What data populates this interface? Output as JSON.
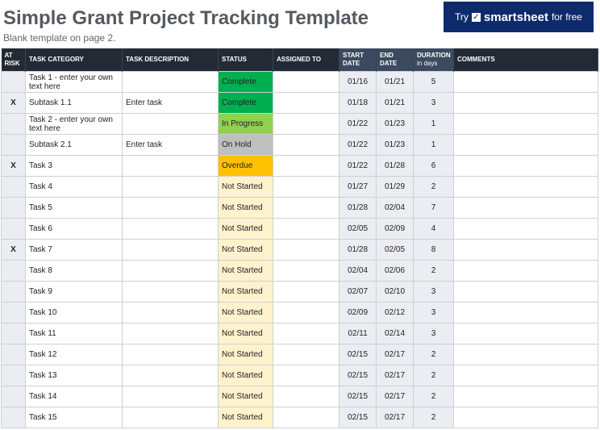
{
  "title": "Simple Grant Project Tracking Template",
  "subtitle": "Blank template on page 2.",
  "banner": {
    "try": "Try",
    "brand": "smartsheet",
    "suffix": "for free",
    "check_glyph": "✓"
  },
  "colors": {
    "complete": "#00b050",
    "in_progress": "#92d050",
    "on_hold": "#bfbfbf",
    "overdue": "#ffc000",
    "not_started": "#fff2cc",
    "header": "#222b35",
    "banner": "#0d2a6b"
  },
  "headers": {
    "at_risk_1": "AT",
    "at_risk_2": "RISK",
    "task_category": "TASK CATEGORY",
    "task_description": "TASK DESCRIPTION",
    "status": "STATUS",
    "assigned_to": "ASSIGNED TO",
    "start_1": "START",
    "start_2": "DATE",
    "end_1": "END",
    "end_2": "DATE",
    "duration_1": "DURATION",
    "duration_2": "in days",
    "comments": "COMMENTS"
  },
  "rows": [
    {
      "risk": "",
      "category": "Task 1 - enter your own text here",
      "description": "",
      "status": "Complete",
      "status_class": "st-complete",
      "assigned": "",
      "start": "01/16",
      "end": "01/21",
      "duration": "5",
      "comments": ""
    },
    {
      "risk": "X",
      "category": "Subtask 1.1",
      "description": "Enter task",
      "status": "Complete",
      "status_class": "st-complete",
      "assigned": "",
      "start": "01/18",
      "end": "01/21",
      "duration": "3",
      "comments": ""
    },
    {
      "risk": "",
      "category": "Task 2 - enter your own text here",
      "description": "",
      "status": "In Progress",
      "status_class": "st-progress",
      "assigned": "",
      "start": "01/22",
      "end": "01/23",
      "duration": "1",
      "comments": ""
    },
    {
      "risk": "",
      "category": "Subtask 2.1",
      "description": "Enter task",
      "status": "On Hold",
      "status_class": "st-hold",
      "assigned": "",
      "start": "01/22",
      "end": "01/23",
      "duration": "1",
      "comments": ""
    },
    {
      "risk": "X",
      "category": "Task 3",
      "description": "",
      "status": "Overdue",
      "status_class": "st-overdue",
      "assigned": "",
      "start": "01/22",
      "end": "01/28",
      "duration": "6",
      "comments": ""
    },
    {
      "risk": "",
      "category": "Task 4",
      "description": "",
      "status": "Not Started",
      "status_class": "st-notstarted",
      "assigned": "",
      "start": "01/27",
      "end": "01/29",
      "duration": "2",
      "comments": ""
    },
    {
      "risk": "",
      "category": "Task 5",
      "description": "",
      "status": "Not Started",
      "status_class": "st-notstarted",
      "assigned": "",
      "start": "01/28",
      "end": "02/04",
      "duration": "7",
      "comments": ""
    },
    {
      "risk": "",
      "category": "Task 6",
      "description": "",
      "status": "Not Started",
      "status_class": "st-notstarted",
      "assigned": "",
      "start": "02/05",
      "end": "02/09",
      "duration": "4",
      "comments": ""
    },
    {
      "risk": "X",
      "category": "Task 7",
      "description": "",
      "status": "Not Started",
      "status_class": "st-notstarted",
      "assigned": "",
      "start": "01/28",
      "end": "02/05",
      "duration": "8",
      "comments": ""
    },
    {
      "risk": "",
      "category": "Task 8",
      "description": "",
      "status": "Not Started",
      "status_class": "st-notstarted",
      "assigned": "",
      "start": "02/04",
      "end": "02/06",
      "duration": "2",
      "comments": ""
    },
    {
      "risk": "",
      "category": "Task 9",
      "description": "",
      "status": "Not Started",
      "status_class": "st-notstarted",
      "assigned": "",
      "start": "02/07",
      "end": "02/10",
      "duration": "3",
      "comments": ""
    },
    {
      "risk": "",
      "category": "Task 10",
      "description": "",
      "status": "Not Started",
      "status_class": "st-notstarted",
      "assigned": "",
      "start": "02/09",
      "end": "02/12",
      "duration": "3",
      "comments": ""
    },
    {
      "risk": "",
      "category": "Task 11",
      "description": "",
      "status": "Not Started",
      "status_class": "st-notstarted",
      "assigned": "",
      "start": "02/11",
      "end": "02/14",
      "duration": "3",
      "comments": ""
    },
    {
      "risk": "",
      "category": "Task 12",
      "description": "",
      "status": "Not Started",
      "status_class": "st-notstarted",
      "assigned": "",
      "start": "02/15",
      "end": "02/17",
      "duration": "2",
      "comments": ""
    },
    {
      "risk": "",
      "category": "Task 13",
      "description": "",
      "status": "Not Started",
      "status_class": "st-notstarted",
      "assigned": "",
      "start": "02/15",
      "end": "02/17",
      "duration": "2",
      "comments": ""
    },
    {
      "risk": "",
      "category": "Task 14",
      "description": "",
      "status": "Not Started",
      "status_class": "st-notstarted",
      "assigned": "",
      "start": "02/15",
      "end": "02/17",
      "duration": "2",
      "comments": ""
    },
    {
      "risk": "",
      "category": "Task 15",
      "description": "",
      "status": "Not Started",
      "status_class": "st-notstarted",
      "assigned": "",
      "start": "02/15",
      "end": "02/17",
      "duration": "2",
      "comments": ""
    }
  ]
}
